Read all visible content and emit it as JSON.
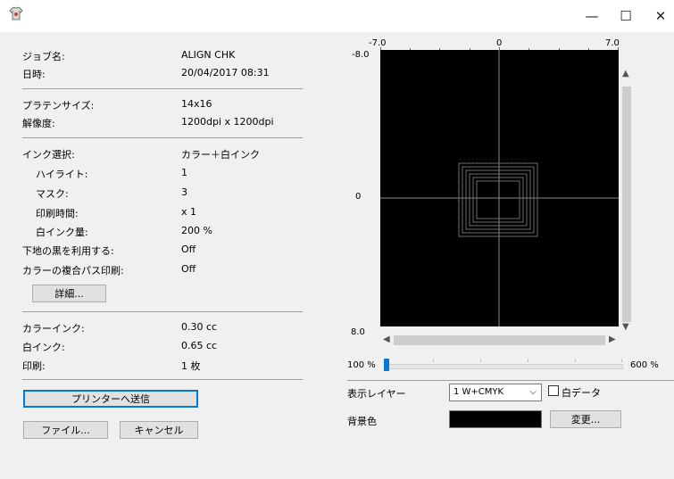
{
  "window": {
    "minimize": "—",
    "maximize": "☐",
    "close": "✕"
  },
  "job": {
    "name_label": "ジョブ名:",
    "name_value": "ALIGN CHK",
    "date_label": "日時:",
    "date_value": "20/04/2017 08:31"
  },
  "platen": {
    "size_label": "プラテンサイズ:",
    "size_value": "14x16",
    "res_label": "解像度:",
    "res_value": "1200dpi x 1200dpi"
  },
  "ink": {
    "select_label": "インク選択:",
    "select_value": "カラー＋白インク",
    "highlight_label": "ハイライト:",
    "highlight_value": "1",
    "mask_label": "マスク:",
    "mask_value": "3",
    "print_time_label": "印刷時間:",
    "print_time_value": "x 1",
    "white_amount_label": "白インク量:",
    "white_amount_value": "200 %",
    "use_black_label": "下地の黒を利用する:",
    "use_black_value": "Off",
    "multipass_label": "カラーの複合パス印刷:",
    "multipass_value": "Off",
    "details_button": "詳細..."
  },
  "usage": {
    "color_ink_label": "カラーインク:",
    "color_ink_value": "0.30 cc",
    "white_ink_label": "白インク:",
    "white_ink_value": "0.65 cc",
    "print_label": "印刷:",
    "print_value": "1 枚"
  },
  "actions": {
    "send": "プリンターへ送信",
    "file": "ファイル...",
    "cancel": "キャンセル"
  },
  "preview": {
    "x_min": "-7.0",
    "x_mid": "0",
    "x_max": "7.0",
    "y_min": "-8.0",
    "y_mid": "0",
    "y_max": "8.0",
    "background": "#000000",
    "pattern_color": "#7a7a7a"
  },
  "zoom": {
    "min_label": "100 %",
    "max_label": "600 %",
    "level_fraction": 0.0
  },
  "layer": {
    "label": "表示レイヤー",
    "value": "1  W+CMYK",
    "white_data_label": "白データ",
    "white_data_checked": false
  },
  "background_color": {
    "label": "背景色",
    "value": "#000000",
    "change_button": "変更..."
  }
}
